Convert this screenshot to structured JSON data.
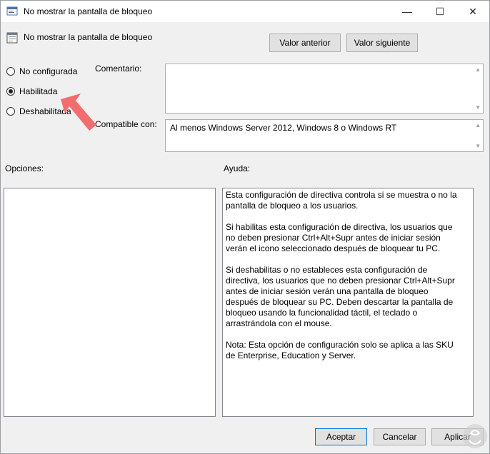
{
  "window": {
    "title": "No mostrar la pantalla de bloqueo",
    "minimize_glyph": "—",
    "maximize_glyph": "☐",
    "close_glyph": "✕"
  },
  "header": {
    "policy_name": "No mostrar la pantalla de bloqueo",
    "prev_button": "Valor anterior",
    "next_button": "Valor siguiente"
  },
  "state": {
    "options": [
      {
        "label": "No configurada",
        "checked": false
      },
      {
        "label": "Habilitada",
        "checked": true
      },
      {
        "label": "Deshabilitada",
        "checked": false
      }
    ]
  },
  "comment": {
    "label": "Comentario:",
    "value": ""
  },
  "compat": {
    "label": "Compatible con:",
    "value": "Al menos Windows Server 2012, Windows 8 o Windows RT"
  },
  "sections": {
    "options_label": "Opciones:",
    "help_label": "Ayuda:"
  },
  "help": {
    "paragraphs": [
      "Esta configuración de directiva controla si se muestra o no la pantalla de bloqueo a los usuarios.",
      "Si habilitas esta configuración de directiva, los usuarios que no deben presionar Ctrl+Alt+Supr antes de iniciar sesión verán el icono seleccionado después de bloquear tu PC.",
      "Si deshabilitas o no estableces esta configuración de directiva, los usuarios que no deben presionar Ctrl+Alt+Supr antes de iniciar sesión verán una pantalla de bloqueo después de bloquear su PC. Deben descartar la pantalla de bloqueo usando la funcionalidad táctil, el teclado o arrastrándola con el mouse.",
      "Nota: Esta opción de configuración solo se aplica a las SKU de Enterprise, Education y Server."
    ]
  },
  "footer": {
    "ok": "Aceptar",
    "cancel": "Cancelar",
    "apply": "Aplicar"
  },
  "colors": {
    "arrow": "#f26d6d",
    "accent": "#0078d7"
  }
}
